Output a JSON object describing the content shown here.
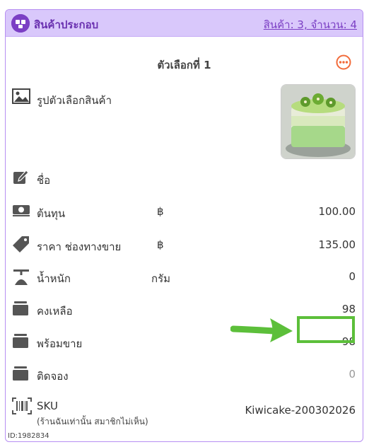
{
  "header": {
    "title": "สินค้าประกอบ",
    "summary": "สินค้า: 3, จำนวน: 4"
  },
  "option": {
    "title": "ตัวเลือกที่ 1",
    "more_icon": "more-horizontal-circle-icon"
  },
  "image_row": {
    "label": "รูปตัวเลือกสินค้า",
    "photo_alt": "kiwi cake"
  },
  "rows": {
    "name": {
      "label": "ชื่อ",
      "icon": "edit-icon"
    },
    "cost": {
      "label": "ต้นทุน",
      "unit": "฿",
      "value": "100.00",
      "icon": "money-icon"
    },
    "price": {
      "label": "ราคา ช่องทางขาย",
      "unit": "฿",
      "value": "135.00",
      "icon": "price-tag-icon"
    },
    "weight": {
      "label": "น้ำหนัก",
      "unit": "กรัม",
      "value": "0",
      "icon": "scale-icon"
    },
    "remaining": {
      "label": "คงเหลือ",
      "value": "98",
      "icon": "box-icon"
    },
    "ready": {
      "label": "พร้อมขาย",
      "value": "98",
      "icon": "box-icon"
    },
    "reserved": {
      "label": "ติดจอง",
      "value": "0",
      "icon": "box-icon"
    },
    "sku": {
      "label": "SKU",
      "sublabel": "(ร้านฉันเท่านั้น สมาชิกไม่เห็น)",
      "value": "Kiwicake-200302026",
      "icon": "barcode-icon"
    }
  },
  "footer": {
    "id": "ID:1982834"
  },
  "colors": {
    "accent": "#7b3fc4",
    "header_bg": "#d9c8fb",
    "highlight": "#5cbf3a",
    "more": "#f26b3a"
  }
}
